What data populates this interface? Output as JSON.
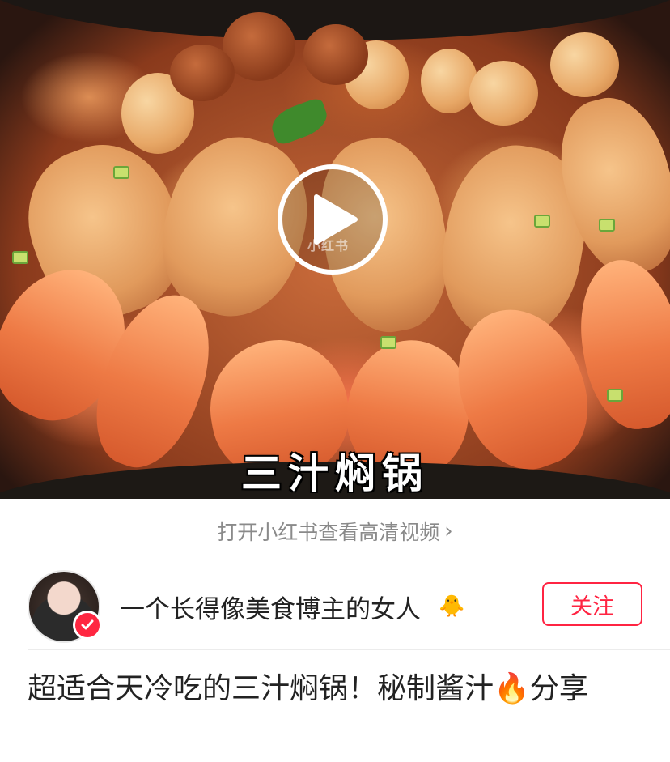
{
  "video": {
    "caption": "三汁焖锅",
    "watermark": "小红书",
    "accent": "#ffffff"
  },
  "open_app": {
    "label": "打开小红书查看高清视频",
    "chevron": "›"
  },
  "author": {
    "name": "一个长得像美食博主的女人",
    "emoji": "🐥",
    "follow_label": "关注",
    "verified_color": "#ff2741"
  },
  "post": {
    "title": "超适合天冷吃的三汁焖锅！秘制酱汁🔥分享"
  },
  "colors": {
    "brand_red": "#ff2442",
    "muted_text": "#8a8a8a"
  }
}
